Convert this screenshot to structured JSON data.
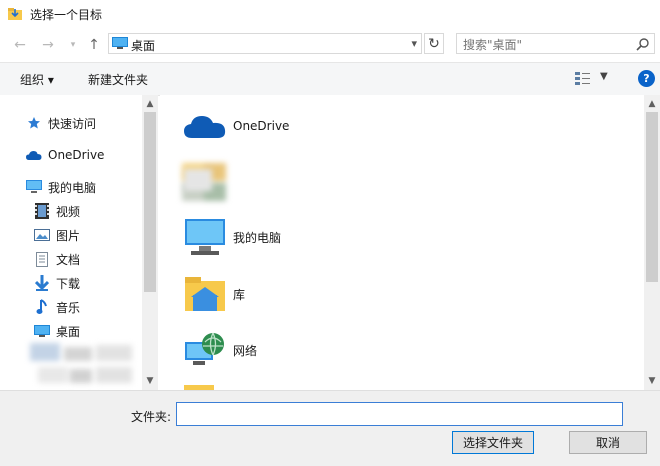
{
  "window": {
    "title": "选择一个目标"
  },
  "address": {
    "location": "桌面",
    "search_placeholder": "搜索\"桌面\""
  },
  "toolbar": {
    "organize": "组织 ▾",
    "new_folder": "新建文件夹"
  },
  "sidebar": {
    "quick_access": "快速访问",
    "onedrive": "OneDrive",
    "this_pc": "我的电脑",
    "items": [
      {
        "label": "视频",
        "icon": "video-icon"
      },
      {
        "label": "图片",
        "icon": "picture-icon"
      },
      {
        "label": "文档",
        "icon": "document-icon"
      },
      {
        "label": "下载",
        "icon": "download-icon"
      },
      {
        "label": "音乐",
        "icon": "music-icon"
      },
      {
        "label": "桌面",
        "icon": "desktop-icon"
      }
    ]
  },
  "files": [
    {
      "label": "OneDrive",
      "icon": "onedrive-cloud-icon"
    },
    {
      "label": "",
      "icon": "blurred-folder-icon"
    },
    {
      "label": "我的电脑",
      "icon": "computer-icon"
    },
    {
      "label": "库",
      "icon": "library-icon"
    },
    {
      "label": "网络",
      "icon": "network-icon"
    }
  ],
  "footer": {
    "folder_label": "文件夹:",
    "folder_value": "",
    "select_button": "选择文件夹",
    "cancel_button": "取消"
  },
  "colors": {
    "accent": "#0078d7",
    "help": "#0a63c9",
    "folder": "#f7c94b"
  }
}
